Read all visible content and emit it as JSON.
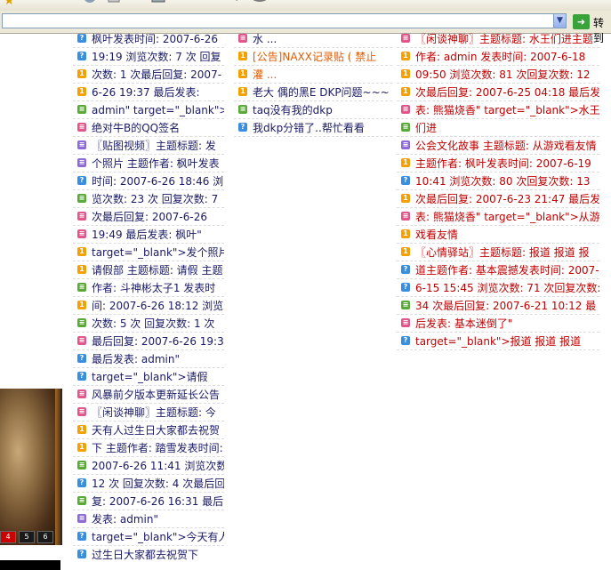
{
  "address_bar": {
    "url": "",
    "go_label": "转到"
  },
  "toolbar": {
    "icons": [
      "star-icon",
      "circle-icon",
      "box-icon",
      "window-icon",
      "back-icon",
      "history-icon",
      "globe-icon"
    ]
  },
  "game_panel": {
    "buttons": [
      "4",
      "5",
      "6"
    ]
  },
  "col1": [
    {
      "icon": "blue",
      "text": "枫叶发表时间: 2007-6-26"
    },
    {
      "icon": "blue",
      "text": "19:19 浏览次数: 7 次 回复"
    },
    {
      "icon": "orange",
      "text": "次数: 1 次最后回复: 2007-"
    },
    {
      "icon": "orange",
      "text": "6-26 19:37 最后发表:"
    },
    {
      "icon": "green",
      "text": "admin\" target=\"_blank\">"
    },
    {
      "icon": "pink",
      "text": "绝对牛B的QQ签名"
    },
    {
      "icon": "purple",
      "text": "〖贴图视频〗主题标题: 发"
    },
    {
      "icon": "purple",
      "text": "个照片 主题作者: 枫叶发表"
    },
    {
      "icon": "blue",
      "text": "时间: 2007-6-26 18:46 浏"
    },
    {
      "icon": "green",
      "text": "览次数: 23 次 回复次数: 7"
    },
    {
      "icon": "pink",
      "text": "次最后回复: 2007-6-26"
    },
    {
      "icon": "pink",
      "text": "19:49 最后发表: 枫叶\""
    },
    {
      "icon": "orange",
      "text": "target=\"_blank\">发个照片"
    },
    {
      "icon": "orange",
      "text": "请假部 主题标题: 请假 主题"
    },
    {
      "icon": "green",
      "text": "作者: 斗神彬太子1 发表时"
    },
    {
      "icon": "orange",
      "text": "间: 2007-6-26 18:12 浏览"
    },
    {
      "icon": "green",
      "text": "次数: 5 次 回复次数: 1 次"
    },
    {
      "icon": "pink",
      "text": "最后回复: 2007-6-26 19:36"
    },
    {
      "icon": "blue",
      "text": "最后发表: admin\""
    },
    {
      "icon": "blue",
      "text": "target=\"_blank\">请假"
    },
    {
      "icon": "pink",
      "text": "风暴前夕版本更新延长公告"
    },
    {
      "icon": "pink",
      "text": "〖闲谈神聊〗主题标题: 今"
    },
    {
      "icon": "orange",
      "text": "天有人过生日大家都去祝贺"
    },
    {
      "icon": "orange",
      "text": "下 主题作者: 踏雪发表时间:"
    },
    {
      "icon": "green",
      "text": "2007-6-26 11:41 浏览次数:"
    },
    {
      "icon": "blue",
      "text": "12 次 回复次数: 4 次最后回"
    },
    {
      "icon": "green",
      "text": "复: 2007-6-26 16:31 最后"
    },
    {
      "icon": "purple",
      "text": "发表: admin\""
    },
    {
      "icon": "blue",
      "text": "target=\"_blank\">今天有人"
    },
    {
      "icon": "blue",
      "text": "过生日大家都去祝贺下"
    }
  ],
  "col2": [
    {
      "icon": "pink",
      "text": "水 ...",
      "red": false
    },
    {
      "icon": "orange",
      "text": "[公告]NAXX记录贴 ( 禁止",
      "red": true
    },
    {
      "icon": "orange",
      "text": "灌 ...",
      "red": true
    },
    {
      "icon": "orange",
      "text": "老大 偶的黑E DKP问题~~~",
      "red": false
    },
    {
      "icon": "green",
      "text": "taq没有我的dkp",
      "red": false
    },
    {
      "icon": "blue",
      "text": "我dkp分错了..帮忙看看",
      "red": false
    }
  ],
  "col3": [
    {
      "icon": "pink",
      "text": "〖闲谈神聊〗主题标题: 水王们进主题"
    },
    {
      "icon": "orange",
      "text": "作者: admin 发表时间: 2007-6-18"
    },
    {
      "icon": "orange",
      "text": "09:50 浏览次数: 81 次回复次数: 12"
    },
    {
      "icon": "orange",
      "text": "次最后回复: 2007-6-25 04:18 最后发"
    },
    {
      "icon": "pink",
      "text": "表: 熊猫烧香\" target=\"_blank\">水王"
    },
    {
      "icon": "green",
      "text": "们进"
    },
    {
      "icon": "purple",
      "text": "公会文化故事 主题标题: 从游戏看友情"
    },
    {
      "icon": "orange",
      "text": "主题作者: 枫叶发表时间: 2007-6-19"
    },
    {
      "icon": "blue",
      "text": "10:41 浏览次数: 80 次回复次数: 13"
    },
    {
      "icon": "orange",
      "text": "次最后回复: 2007-6-23 21:47 最后发"
    },
    {
      "icon": "pink",
      "text": "表: 熊猫烧香\" target=\"_blank\">从游"
    },
    {
      "icon": "orange",
      "text": "戏看友情"
    },
    {
      "icon": "orange",
      "text": "〖心情驿站〗主题标题: 报道 报道 报"
    },
    {
      "icon": "blue",
      "text": "道主题作者: 基本震撼发表时间: 2007-"
    },
    {
      "icon": "blue",
      "text": "6-15 15:45 浏览次数: 71 次回复次数:"
    },
    {
      "icon": "green",
      "text": "34 次最后回复: 2007-6-21 10:12 最"
    },
    {
      "icon": "pink",
      "text": "后发表: 基本迷倒了\""
    },
    {
      "icon": "blue",
      "text": "target=\"_blank\">报道 报道 报道"
    }
  ]
}
